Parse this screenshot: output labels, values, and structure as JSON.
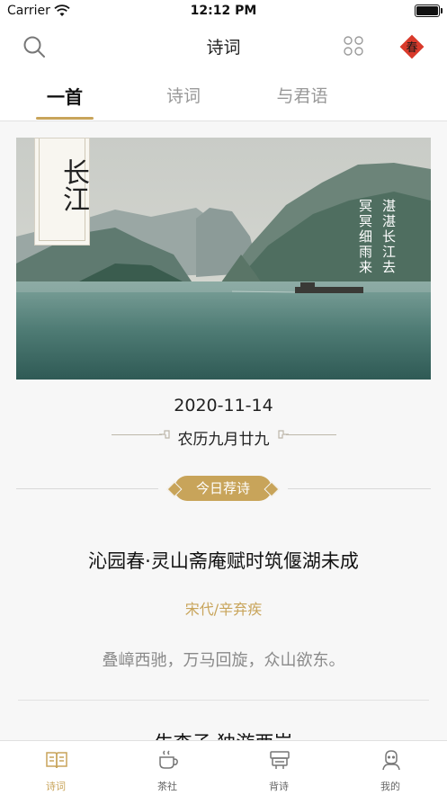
{
  "status_bar": {
    "carrier": "Carrier",
    "time": "12:12 PM"
  },
  "nav": {
    "title": "诗词",
    "seal_char": "春"
  },
  "tabs": [
    {
      "label": "一首",
      "active": true
    },
    {
      "label": "诗词",
      "active": false
    },
    {
      "label": "与君语",
      "active": false
    }
  ],
  "hero": {
    "place": "长江",
    "poem_col1": "湛湛长江去",
    "poem_col2": "冥冥细雨来"
  },
  "date": {
    "gregorian": "2020-11-14",
    "lunar": "农历九月廿九"
  },
  "recommend": {
    "label": "今日荐诗",
    "poem_title": "沁园春·灵山斋庵赋时筑偃湖未成",
    "author": "宋代/辛弃疾",
    "first_line": "叠嶂西驰，万马回旋，众山欲东。",
    "next_title": "生查子·独游西岩"
  },
  "tabbar": [
    {
      "label": "诗词",
      "icon": "book-icon",
      "active": true
    },
    {
      "label": "茶社",
      "icon": "tea-cup-icon",
      "active": false
    },
    {
      "label": "背诗",
      "icon": "recite-icon",
      "active": false
    },
    {
      "label": "我的",
      "icon": "profile-icon",
      "active": false
    }
  ],
  "colors": {
    "accent": "#c8a45a",
    "seal_red": "#d93a2b"
  }
}
